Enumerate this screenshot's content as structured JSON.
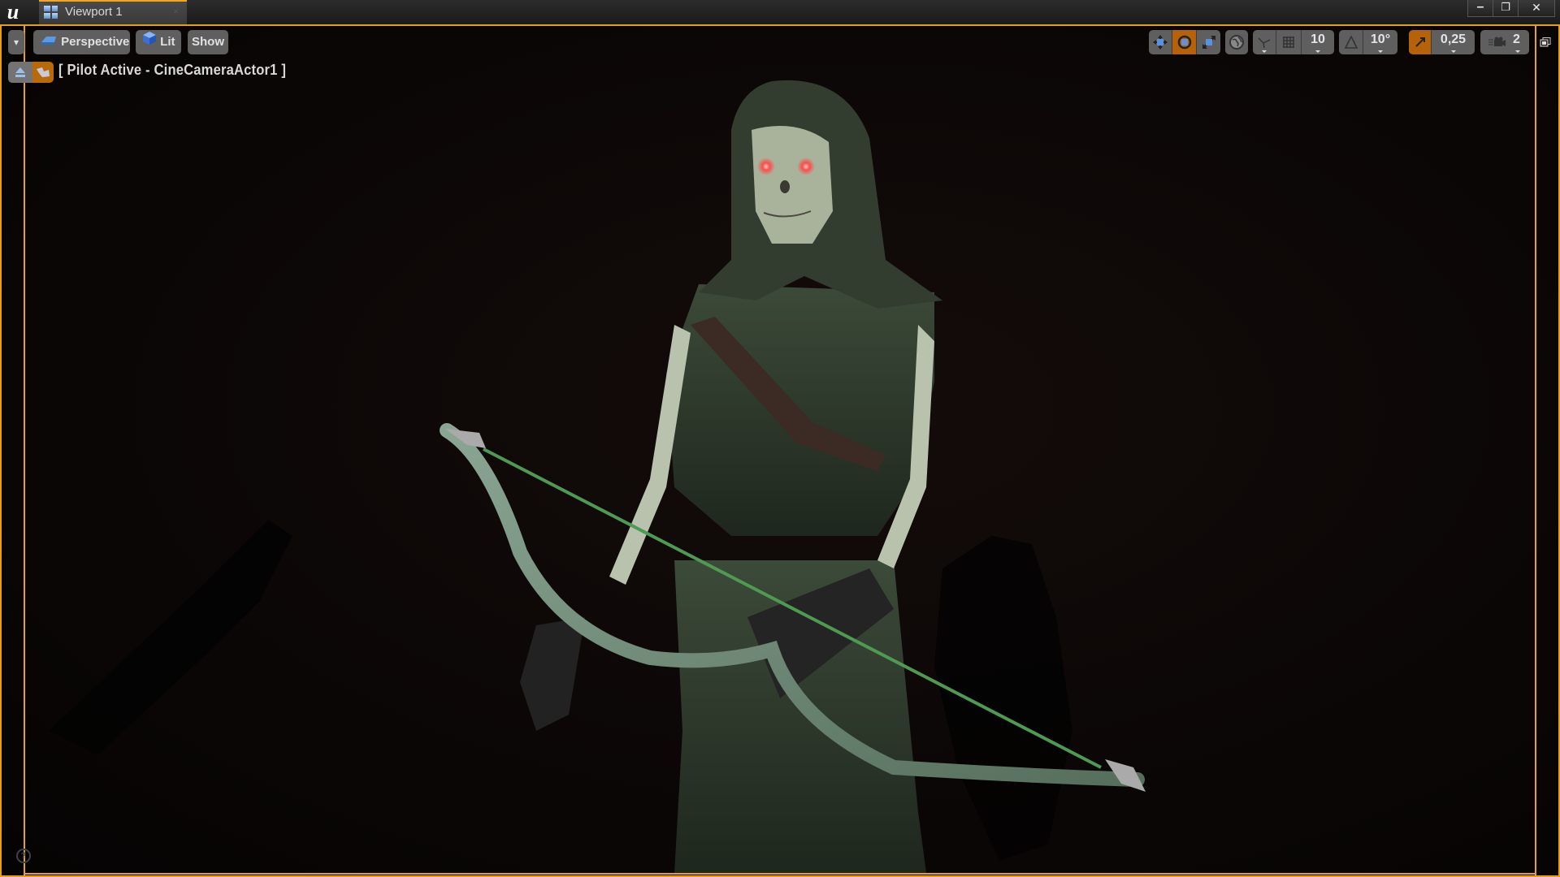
{
  "window": {
    "tab_title": "Viewport 1",
    "tab_close_glyph": "×",
    "controls": {
      "minimize": "–",
      "restore": "❐",
      "close": "✕"
    },
    "accent_color": "#e6a414"
  },
  "viewport_toolbar": {
    "options_dropdown": "▾",
    "view_mode": "Perspective",
    "lighting_mode": "Lit",
    "show_label": "Show",
    "transform_tools": [
      {
        "name": "translate",
        "icon": "move-arrows-icon",
        "active": false
      },
      {
        "name": "rotate",
        "icon": "rotate-icon",
        "active": true
      },
      {
        "name": "scale",
        "icon": "scale-icon",
        "active": false
      }
    ],
    "coordinate_system_icon": "globe-icon",
    "surface_snapping_icon": "surface-snap-icon",
    "grid_snap_icon": "grid-icon",
    "grid_snap_value": "10",
    "rotation_snap_icon": "angle-icon",
    "rotation_snap_value": "10°",
    "scale_snap_icon": "scale-snap-icon",
    "scale_snap_value": "0,25",
    "camera_speed_icon": "camera-speed-icon",
    "camera_speed_value": "2"
  },
  "pilot_bar": {
    "label": "[ Pilot Active - CineCameraActor1 ]",
    "eject_icon": "eject-icon",
    "pilot_icon": "pilot-camera-icon"
  },
  "scene": {
    "subject": "Hooded skeleton archer holding a bow",
    "eye_color": "#ff4a4a",
    "cloth_color": "#2e3a2c",
    "bone_color": "#b8c2ad",
    "bowstring_color": "#4f9a52"
  },
  "help_glyph": "?"
}
